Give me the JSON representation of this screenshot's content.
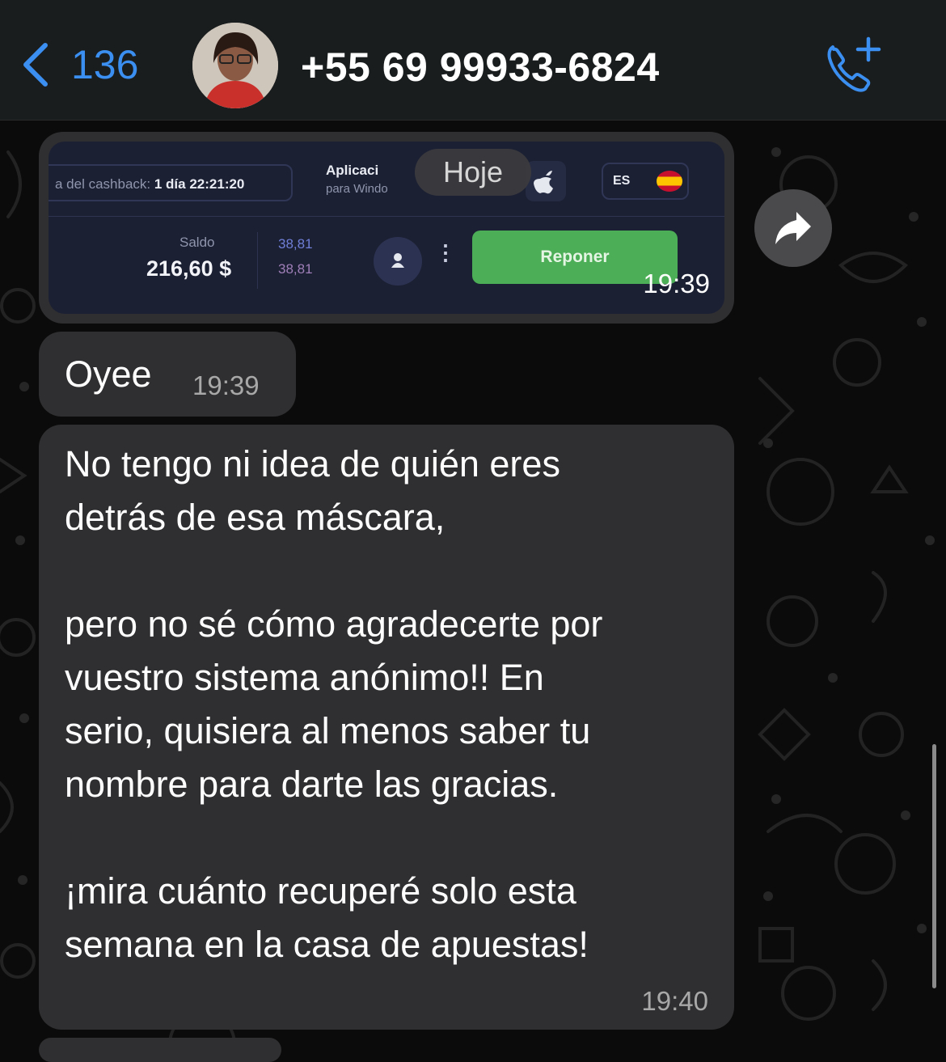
{
  "header": {
    "back_count": "136",
    "contact_name": "+55 69 99933-6824"
  },
  "date_chip": "Hoje",
  "messages": [
    {
      "type": "image",
      "time": "19:39",
      "screenshot": {
        "cashback_label": "a del cashback:",
        "cashback_timer": "1 día 22:21:20",
        "app_title": "Aplicaci",
        "app_subtitle": "para Windo",
        "lang": "ES",
        "balance_label": "Saldo",
        "balance_value": "216,60 $",
        "mini_value_1": "38,81",
        "mini_value_2": "38,81",
        "button_label": "Reponer"
      }
    },
    {
      "type": "text",
      "text": "Oyee",
      "time": "19:39"
    },
    {
      "type": "text",
      "text": "No tengo ni idea de quién eres\ndetrás de esa máscara,\n\npero no sé cómo agradecerte por\nvuestro sistema anónimo!! En\nserio, quisiera al menos saber tu\nnombre para darte las gracias.\n\n¡mira cuánto recuperé solo esta\nsemana en la casa de apuestas!",
      "time": "19:40"
    }
  ],
  "colors": {
    "accent": "#3b8ff0",
    "bubble": "#2f2f31",
    "background": "#0b0b0b",
    "reponer_green": "#4cae56"
  }
}
